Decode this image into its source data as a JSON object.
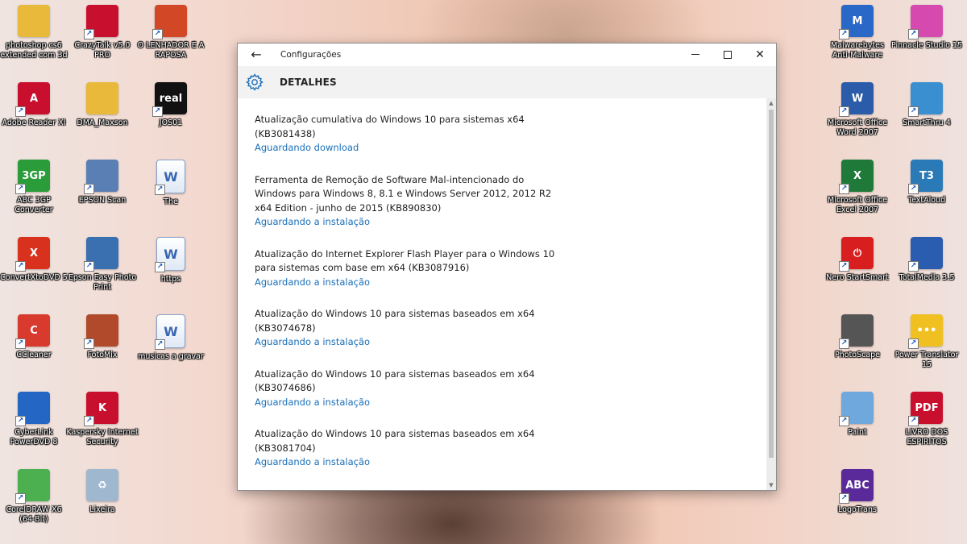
{
  "desktop": {
    "icons_left": [
      {
        "label": "photoshop cs6 extended com 3d",
        "icon": "folder-icon",
        "color": "#e8b93a",
        "glyph": ""
      },
      {
        "label": "CrazyTalk v5.0 PRO",
        "icon": "lips-icon",
        "color": "#c8102e",
        "glyph": ""
      },
      {
        "label": "O LENHADOR E A RAPOSA",
        "icon": "presentation-icon",
        "color": "#d24726",
        "glyph": ""
      },
      {
        "label": "Adobe Reader XI",
        "icon": "pdf-icon",
        "color": "#c8102e",
        "glyph": "A"
      },
      {
        "label": "DMA_Maxson",
        "icon": "folder-icon",
        "color": "#e8b93a",
        "glyph": ""
      },
      {
        "label": "JOS01",
        "icon": "realplayer-icon",
        "color": "#111111",
        "glyph": "real"
      },
      {
        "label": "ABC 3GP Converter",
        "icon": "3gp-icon",
        "color": "#2a9d3a",
        "glyph": "3GP"
      },
      {
        "label": "EPSON Scan",
        "icon": "scanner-icon",
        "color": "#5a7fb5",
        "glyph": ""
      },
      {
        "label": "The",
        "icon": "word-doc-icon",
        "color": "#ffffff",
        "glyph": "W"
      },
      {
        "label": "ConvertXtoDVD 5",
        "icon": "convertx-icon",
        "color": "#d8321e",
        "glyph": "X"
      },
      {
        "label": "Epson Easy Photo Print",
        "icon": "photo-print-icon",
        "color": "#3a6fb0",
        "glyph": ""
      },
      {
        "label": "https",
        "icon": "word-doc-icon",
        "color": "#ffffff",
        "glyph": "W"
      },
      {
        "label": "CCleaner",
        "icon": "ccleaner-icon",
        "color": "#d83a2e",
        "glyph": "C"
      },
      {
        "label": "FotoMix",
        "icon": "fotomix-icon",
        "color": "#b04a2a",
        "glyph": ""
      },
      {
        "label": "musicas a gravar",
        "icon": "word-doc-icon",
        "color": "#ffffff",
        "glyph": "W"
      },
      {
        "label": "CyberLink PowerDVD 8",
        "icon": "powerdvd-icon",
        "color": "#2466c4",
        "glyph": ""
      },
      {
        "label": "Kaspersky Internet Security",
        "icon": "kaspersky-icon",
        "color": "#c8102e",
        "glyph": "K"
      },
      {
        "label": "",
        "icon": "",
        "color": "",
        "glyph": ""
      },
      {
        "label": "CorelDRAW X6 (64-Bit)",
        "icon": "coreldraw-icon",
        "color": "#4caf50",
        "glyph": ""
      },
      {
        "label": "Lixeira",
        "icon": "recycle-bin-icon",
        "color": "#9fb7cf",
        "glyph": "♻"
      }
    ],
    "icons_right": [
      {
        "label": "Malwarebytes Anti-Malware",
        "icon": "malwarebytes-icon",
        "color": "#2a68c8",
        "glyph": "M"
      },
      {
        "label": "Pinnacle Studio 15",
        "icon": "pinnacle-icon",
        "color": "#d64ab0",
        "glyph": ""
      },
      {
        "label": "Microsoft Office Word 2007",
        "icon": "word-icon",
        "color": "#2a5caa",
        "glyph": "W"
      },
      {
        "label": "SmartThru 4",
        "icon": "smartthru-icon",
        "color": "#3a8fd0",
        "glyph": ""
      },
      {
        "label": "Microsoft Office Excel 2007",
        "icon": "excel-icon",
        "color": "#1f7a3a",
        "glyph": "X"
      },
      {
        "label": "TextAloud",
        "icon": "textaloud-icon",
        "color": "#2a7ab8",
        "glyph": "T3"
      },
      {
        "label": "Nero StartSmart",
        "icon": "nero-icon",
        "color": "#d81e1e",
        "glyph": "⏻"
      },
      {
        "label": "TotalMedia 3.5",
        "icon": "totalmedia-icon",
        "color": "#2a5cb0",
        "glyph": ""
      },
      {
        "label": "PhotoScape",
        "icon": "photoscape-icon",
        "color": "#555555",
        "glyph": ""
      },
      {
        "label": "Power Translator 15",
        "icon": "power-translator-icon",
        "color": "#f0c020",
        "glyph": "•••"
      },
      {
        "label": "Paint",
        "icon": "paint-icon",
        "color": "#6fa8dc",
        "glyph": ""
      },
      {
        "label": "LIVRO DOS ESPIRITOS",
        "icon": "pdf-icon",
        "color": "#c8102e",
        "glyph": "PDF"
      },
      {
        "label": "LogoTrans",
        "icon": "logotrans-icon",
        "color": "#5a2a9a",
        "glyph": "ABC"
      }
    ]
  },
  "window": {
    "title": "Configurações",
    "header_title": "DETALHES",
    "updates": [
      {
        "name": "Atualização cumulativa do Windows 10 para sistemas x64\n(KB3081438)",
        "status": "Aguardando download"
      },
      {
        "name": "Ferramenta de Remoção de Software Mal-intencionado do\nWindows para Windows 8, 8.1 e Windows Server 2012, 2012 R2\nx64 Edition - junho de 2015 (KB890830)",
        "status": "Aguardando a instalação"
      },
      {
        "name": "Atualização do Internet Explorer Flash Player para o Windows 10\npara sistemas com base em x64 (KB3087916)",
        "status": "Aguardando a instalação"
      },
      {
        "name": "Atualização do Windows 10 para sistemas baseados em x64\n(KB3074678)",
        "status": "Aguardando a instalação"
      },
      {
        "name": "Atualização do Windows 10 para sistemas baseados em x64\n(KB3074686)",
        "status": "Aguardando a instalação"
      },
      {
        "name": "Atualização do Windows 10 para sistemas baseados em x64\n(KB3081704)",
        "status": "Aguardando a instalação"
      }
    ]
  }
}
